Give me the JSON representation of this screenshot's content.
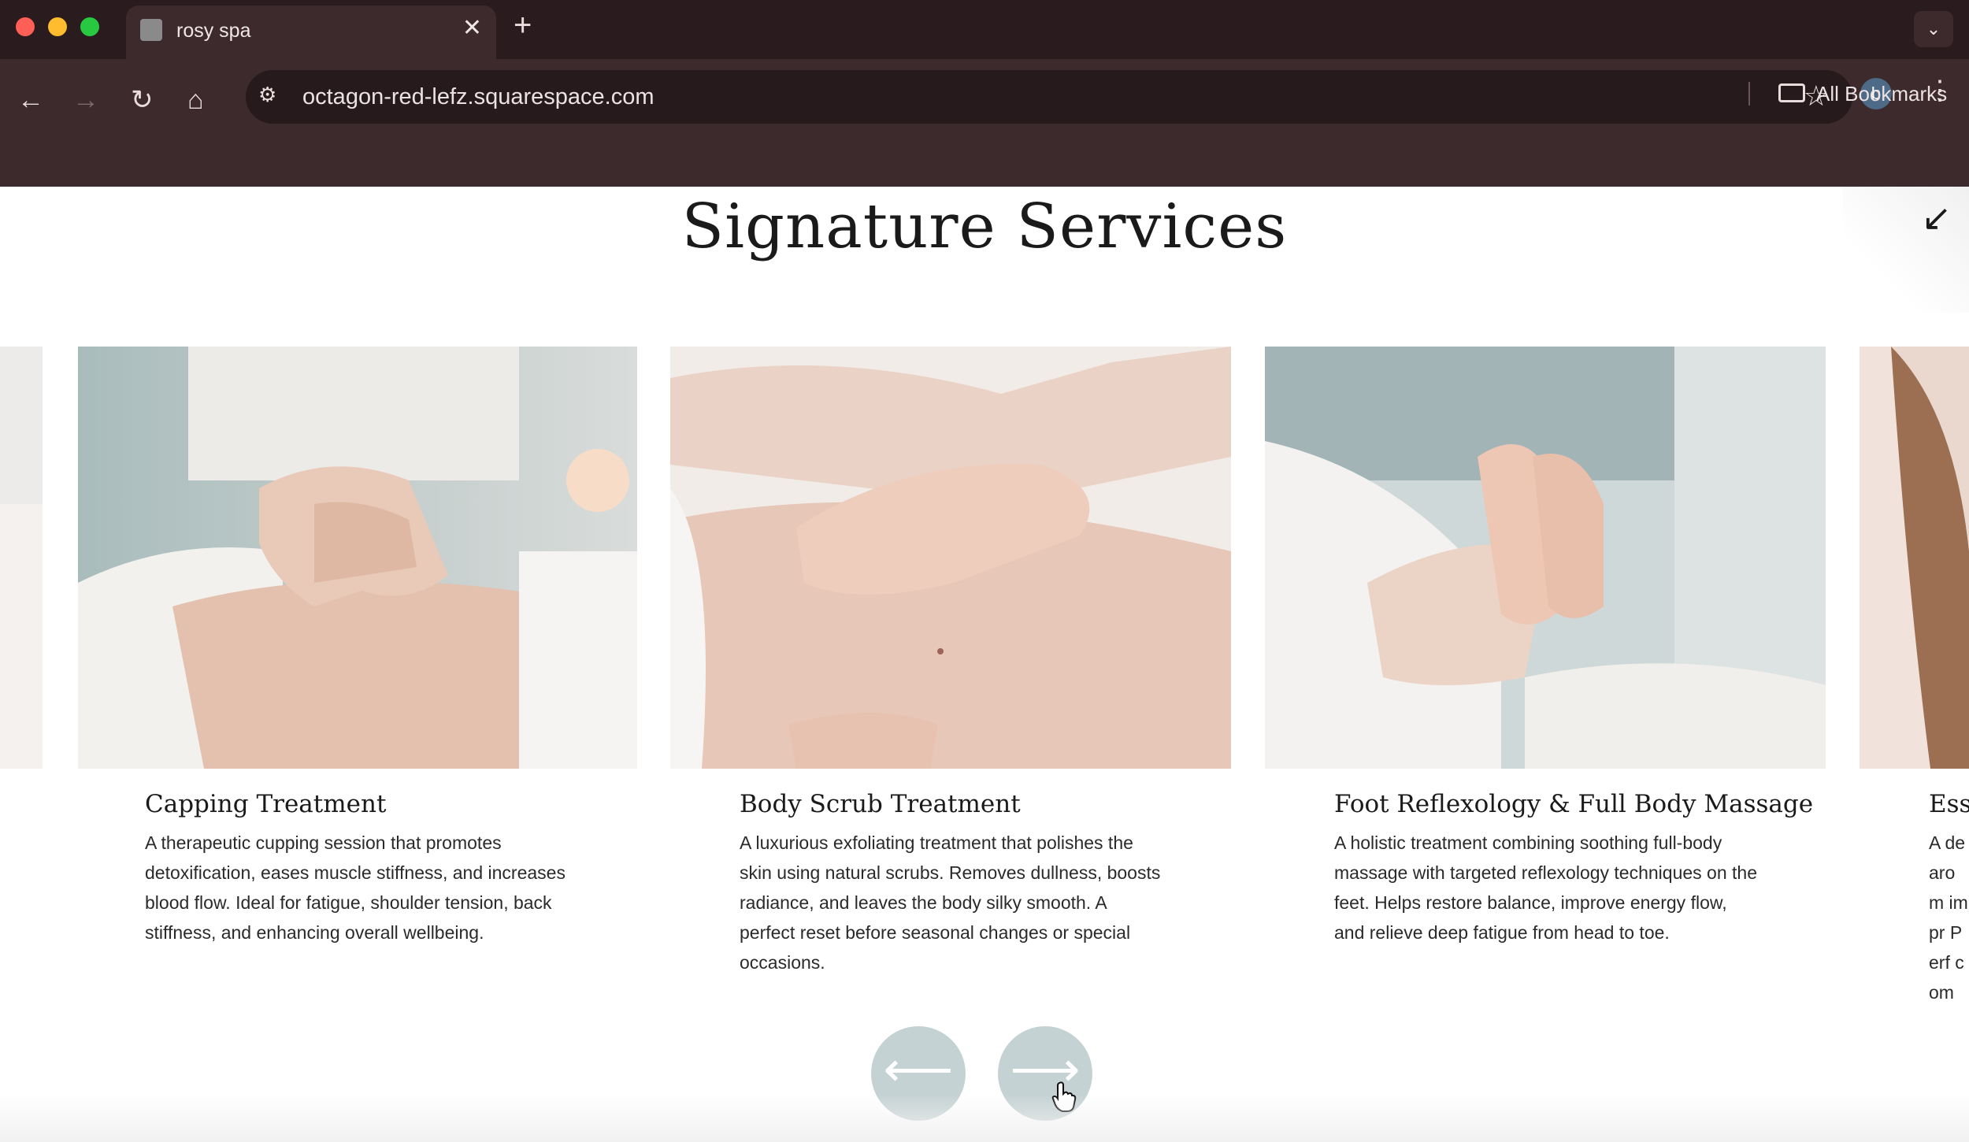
{
  "browser": {
    "tab_title": "rosy spa",
    "new_tab_icon": "+",
    "close_tab_icon": "✕",
    "tab_menu_icon": "⌄",
    "url": "octagon-red-lefz.squarespace.com",
    "profile_initial": "b",
    "bookmarks_label": "All Bookmarks",
    "nav_icons": {
      "back": "←",
      "forward": "→",
      "reload": "↻",
      "home": "⌂",
      "site_info": "⚙",
      "star": "☆",
      "menu": "⋮"
    }
  },
  "page": {
    "heading": "Signature Services",
    "corner_icon": "↙",
    "cards": [
      {
        "title": "Capping Treatment",
        "description": "A therapeutic cupping session that promotes detoxification, eases muscle stiffness, and increases blood flow. Ideal for fatigue, shoulder tension, back stiffness, and enhancing overall wellbeing."
      },
      {
        "title": "Body Scrub Treatment",
        "description": "A luxurious exfoliating treatment that polishes the skin using natural scrubs. Removes dullness, boosts radiance, and leaves the body silky smooth. A perfect reset before seasonal changes or special occasions."
      },
      {
        "title": "Foot Reflexology & Full Body Massage",
        "description": "A holistic treatment combining soothing full-body massage with targeted reflexology techniques on the feet. Helps restore balance, improve energy flow, and relieve deep fatigue from head to toe."
      },
      {
        "title": "Esse",
        "description": "A de arom impr Perf com"
      }
    ],
    "prev_arrow": "⟵",
    "next_arrow": "⟶"
  },
  "colors": {
    "chrome_dark": "#2a1b1e",
    "chrome_toolbar": "#3d2a2d",
    "arrow_button": "#c5d2d3"
  }
}
